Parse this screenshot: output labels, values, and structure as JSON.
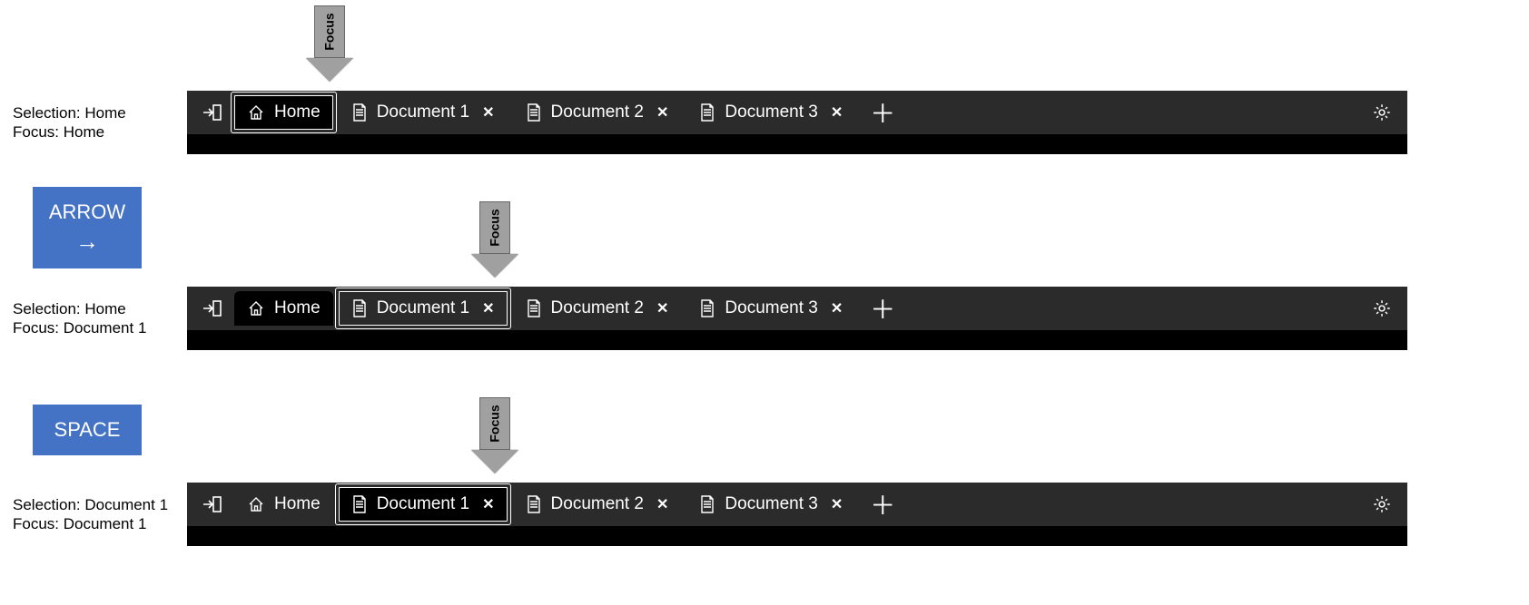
{
  "pointer_label": "Focus",
  "keys": {
    "arrow": "ARROW",
    "arrow_glyph": "→",
    "space": "SPACE"
  },
  "states": [
    {
      "selection_label": "Selection: Home",
      "focus_label": "Focus: Home",
      "tabs": [
        {
          "label": "Home",
          "has_close": false,
          "selected": true,
          "focused": true
        },
        {
          "label": "Document 1",
          "has_close": true,
          "selected": false,
          "focused": false
        },
        {
          "label": "Document 2",
          "has_close": true,
          "selected": false,
          "focused": false
        },
        {
          "label": "Document 3",
          "has_close": true,
          "selected": false,
          "focused": false
        }
      ]
    },
    {
      "selection_label": "Selection: Home",
      "focus_label": "Focus: Document 1",
      "tabs": [
        {
          "label": "Home",
          "has_close": false,
          "selected": true,
          "focused": false
        },
        {
          "label": "Document 1",
          "has_close": true,
          "selected": false,
          "focused": true
        },
        {
          "label": "Document 2",
          "has_close": true,
          "selected": false,
          "focused": false
        },
        {
          "label": "Document 3",
          "has_close": true,
          "selected": false,
          "focused": false
        }
      ]
    },
    {
      "selection_label": "Selection: Document 1",
      "focus_label": "Focus: Document 1",
      "tabs": [
        {
          "label": "Home",
          "has_close": false,
          "selected": false,
          "focused": false
        },
        {
          "label": "Document 1",
          "has_close": true,
          "selected": true,
          "focused": true
        },
        {
          "label": "Document 2",
          "has_close": true,
          "selected": false,
          "focused": false
        },
        {
          "label": "Document 3",
          "has_close": true,
          "selected": false,
          "focused": false
        }
      ]
    }
  ]
}
